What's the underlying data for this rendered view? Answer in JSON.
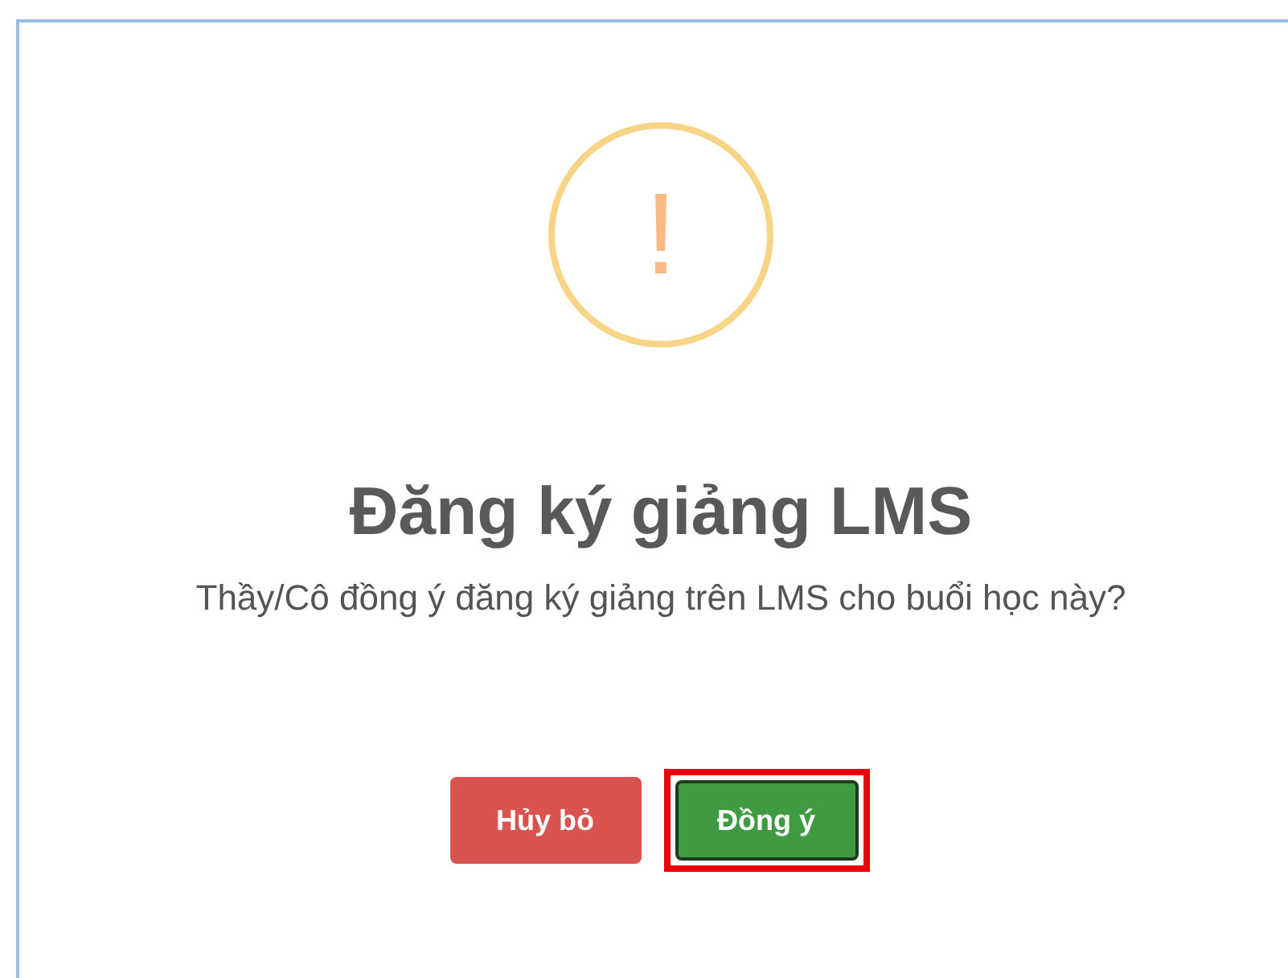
{
  "dialog": {
    "icon": "!",
    "title": "Đăng ký giảng LMS",
    "message": "Thầy/Cô đồng ý đăng ký giảng trên LMS cho buổi học này?",
    "buttons": [
      {
        "label": "Hủy bỏ",
        "kind": "cancel",
        "highlighted": false
      },
      {
        "label": "Đồng ý",
        "kind": "confirm",
        "highlighted": true
      }
    ]
  }
}
